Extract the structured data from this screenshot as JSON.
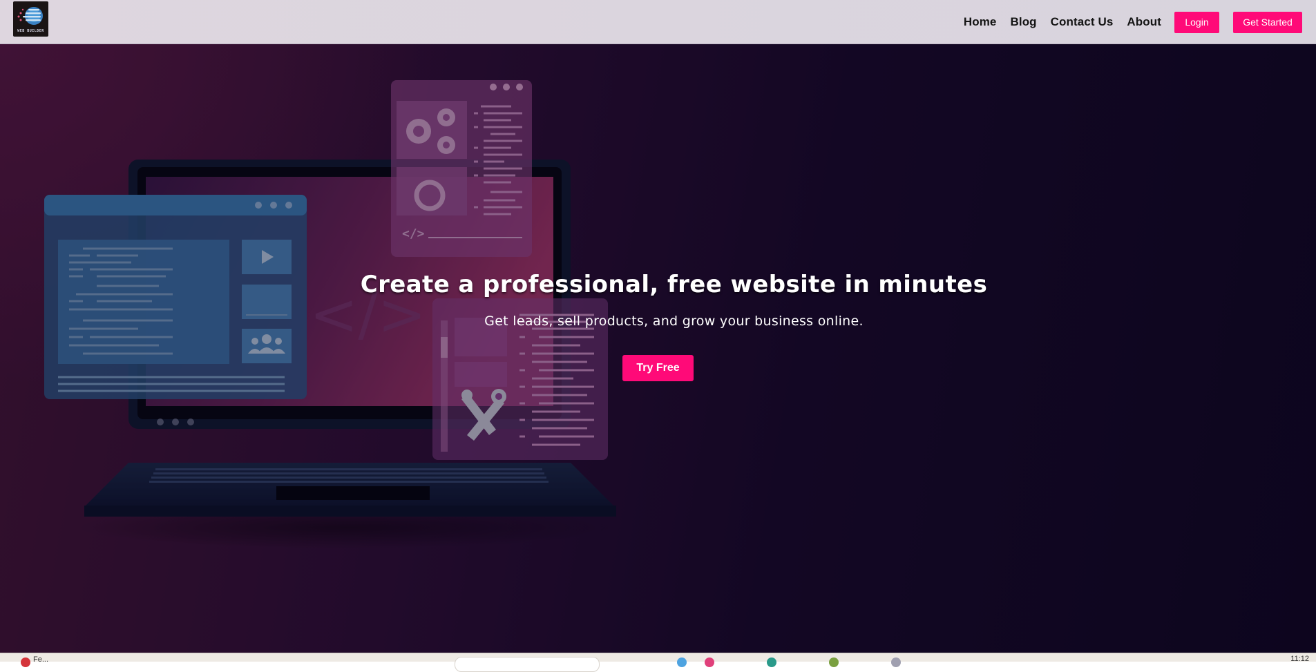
{
  "nav": {
    "logo_text": "WEB BUILDER",
    "links": [
      "Home",
      "Blog",
      "Contact Us",
      "About"
    ],
    "login_label": "Login",
    "get_started_label": "Get Started"
  },
  "hero": {
    "title": "Create a professional, free website in minutes",
    "subtitle": "Get leads, sell products, and grow your business online.",
    "cta_label": "Try Free"
  },
  "taskbar": {
    "notification_text": "Fe...",
    "clock": "11:12"
  },
  "colors": {
    "accent": "#ff0a78",
    "nav_background": "#dcd6de",
    "hero_background": "#1e0b2c"
  },
  "icons": [
    "code-icon",
    "gear-icon",
    "play-icon",
    "users-icon",
    "tools-icon",
    "laptop-illustration"
  ]
}
